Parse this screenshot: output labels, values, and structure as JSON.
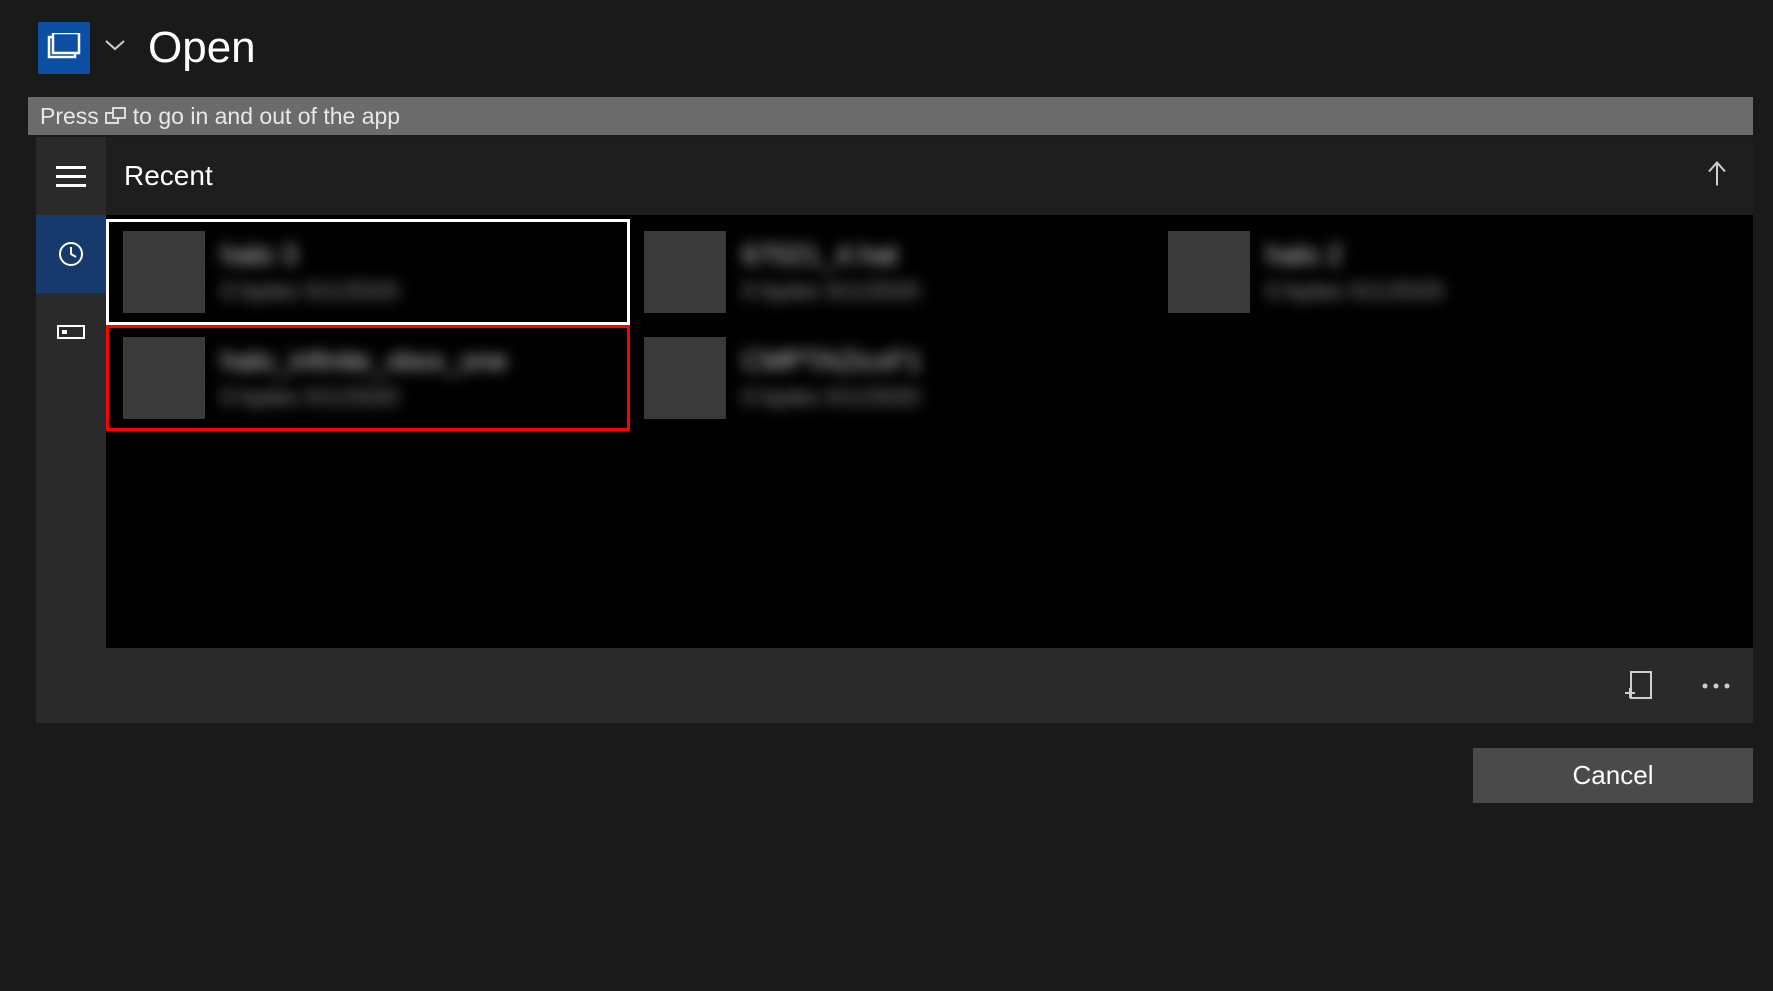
{
  "window": {
    "title": "Open"
  },
  "hint": {
    "prefix": "Press",
    "suffix": "to go in and out of the app"
  },
  "section": {
    "title": "Recent"
  },
  "files": [
    {
      "name": "halo 3",
      "meta": "0 bytes 5/1/2020",
      "selected": true,
      "highlighted": false
    },
    {
      "name": "67021_4.hat",
      "meta": "0 bytes 5/1/2020",
      "selected": false,
      "highlighted": false
    },
    {
      "name": "halo 2",
      "meta": "0 bytes 5/1/2020",
      "selected": false,
      "highlighted": false
    },
    {
      "name": "halo_infinite_xbox_one",
      "meta": "0 bytes 5/1/2020",
      "selected": false,
      "highlighted": true
    },
    {
      "name": "CMPTAZicxF1",
      "meta": "0 bytes 5/1/2020",
      "selected": false,
      "highlighted": false
    }
  ],
  "buttons": {
    "cancel": "Cancel"
  }
}
